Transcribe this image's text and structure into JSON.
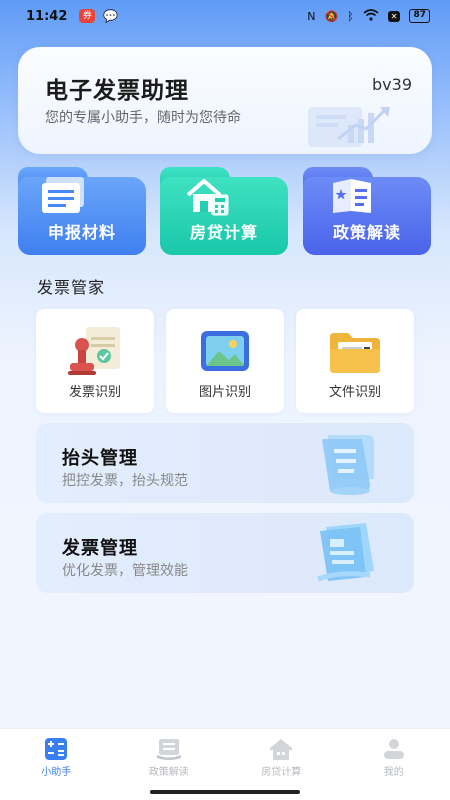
{
  "status_bar": {
    "time": "11:42",
    "battery": "87"
  },
  "header": {
    "title": "电子发票助理",
    "subtitle": "您的专属小助手，随时为您待命",
    "version": "bv39"
  },
  "quick_tiles": [
    {
      "label": "申报材料",
      "icon": "documents-icon",
      "color": "#4a88f3"
    },
    {
      "label": "房贷计算",
      "icon": "house-calculator-icon",
      "color": "#22cfb0"
    },
    {
      "label": "政策解读",
      "icon": "policy-book-icon",
      "color": "#566ff0"
    }
  ],
  "section": {
    "title": "发票管家"
  },
  "recognition": [
    {
      "label": "发票识别",
      "icon": "stamp-icon"
    },
    {
      "label": "图片识别",
      "icon": "image-icon"
    },
    {
      "label": "文件识别",
      "icon": "folder-icon"
    }
  ],
  "manage_cards": [
    {
      "title": "抬头管理",
      "subtitle": "把控发票，抬头规范",
      "icon": "scroll-document-icon"
    },
    {
      "title": "发票管理",
      "subtitle": "优化发票，管理效能",
      "icon": "scroll-document-icon"
    }
  ],
  "bottom_nav": [
    {
      "label": "小助手",
      "icon": "calculator-icon",
      "active": true
    },
    {
      "label": "政策解读",
      "icon": "book-icon",
      "active": false
    },
    {
      "label": "房贷计算",
      "icon": "house-icon",
      "active": false
    },
    {
      "label": "我的",
      "icon": "user-icon",
      "active": false
    }
  ],
  "colors": {
    "accent": "#3a7ff0",
    "inactive": "#b5b8be"
  }
}
